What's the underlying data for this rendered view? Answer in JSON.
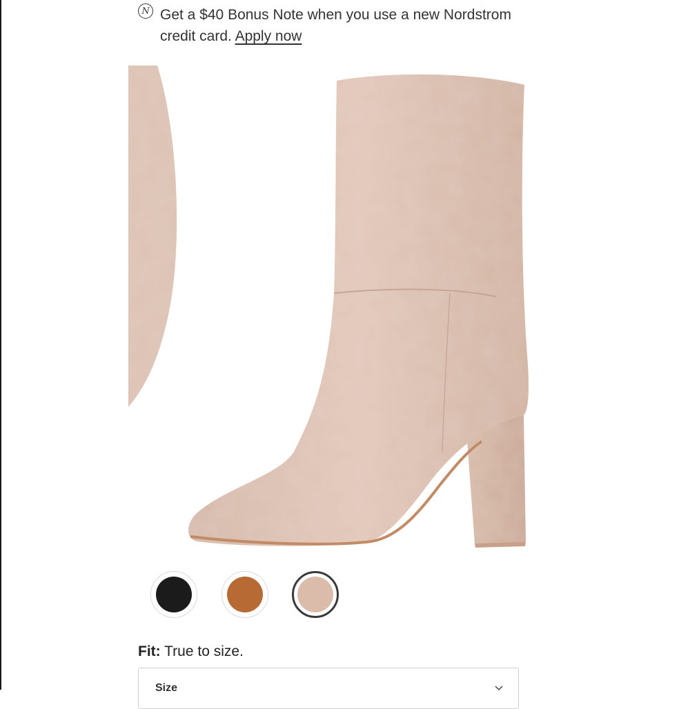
{
  "promo": {
    "icon": "nordstrom-n-icon",
    "icon_glyph": "N",
    "text": "Get a $40 Bonus Note when you use a new Nordstrom credit card.",
    "link_label": "Apply now"
  },
  "gallery": {
    "images": [
      {
        "name": "boot-closeup-partial"
      },
      {
        "name": "boot-side-view"
      }
    ]
  },
  "swatches": [
    {
      "name": "Black",
      "color": "#1b1b1b",
      "selected": false
    },
    {
      "name": "Cognac",
      "color": "#b86a34",
      "selected": false
    },
    {
      "name": "Taupe",
      "color": "#dbbcab",
      "selected": true
    }
  ],
  "fit": {
    "label": "Fit:",
    "value": "True to size."
  },
  "size": {
    "label": "Size",
    "icon": "chevron-down-icon"
  }
}
